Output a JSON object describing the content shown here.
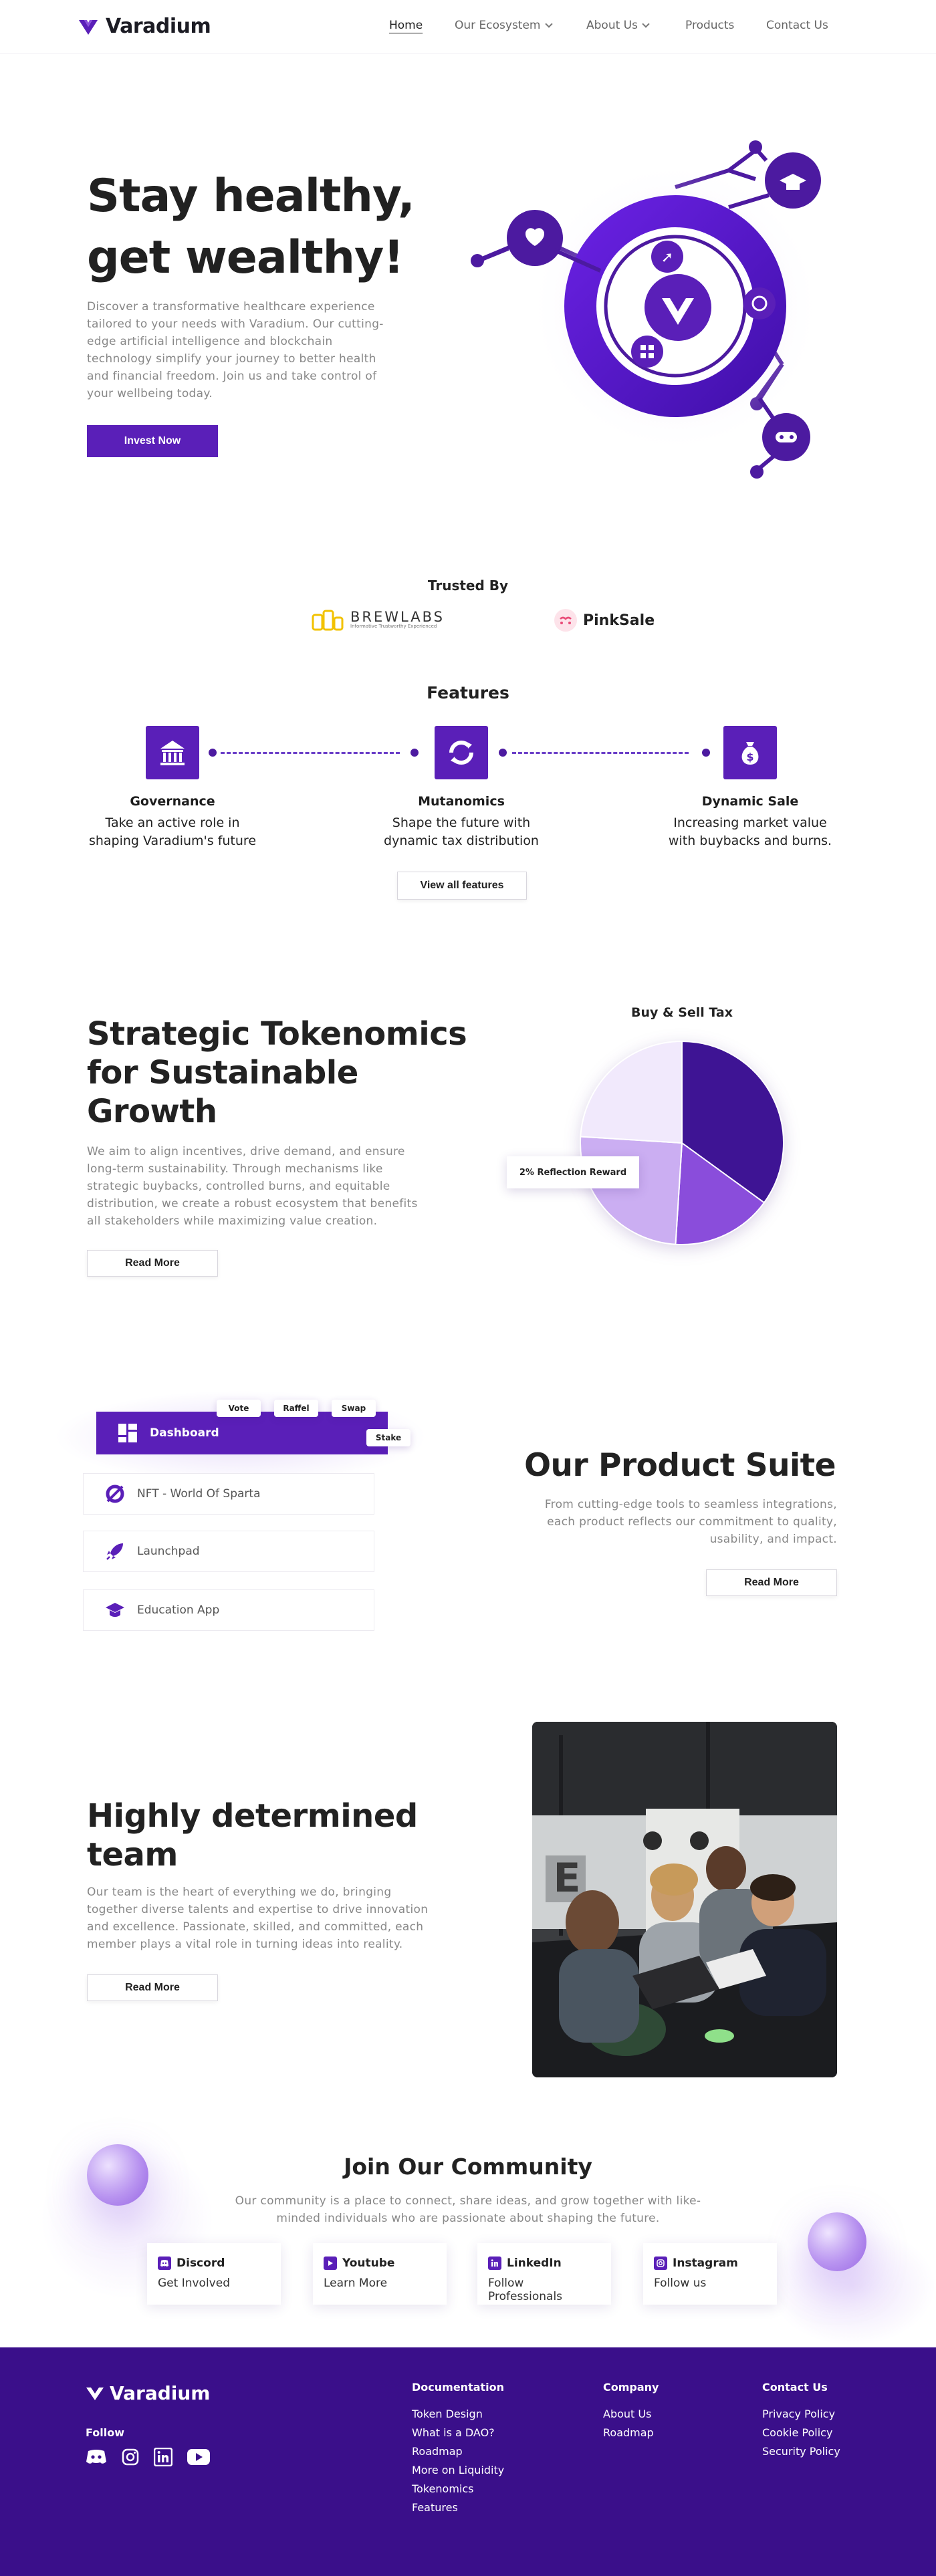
{
  "nav": {
    "brand": "Varadium",
    "items": [
      {
        "label": "Home"
      },
      {
        "label": "Our Ecosystem"
      },
      {
        "label": "About Us"
      },
      {
        "label": "Products"
      },
      {
        "label": "Contact Us"
      }
    ]
  },
  "hero": {
    "title_line1": "Stay healthy,",
    "title_line2": "get wealthy!",
    "text": "Discover a transformative healthcare experience tailored to your needs with Varadium. Our cutting-edge artificial intelligence and blockchain technology simplify your journey to better health and financial freedom. Join us and take control of your wellbeing today.",
    "cta": "Invest Now",
    "icons": [
      "heart-pulse-icon",
      "graduation-cap-icon",
      "rocket-icon",
      "refresh-icon",
      "apps-icon",
      "gamepad-icon",
      "varadium-logo"
    ]
  },
  "trusted": {
    "title": "Trusted By",
    "brewlabs": "BREWLABS",
    "brewlabs_tagline": "Informative Trustworthy Experienced",
    "pinksale": "PinkSale"
  },
  "features": {
    "title": "Features",
    "items": [
      {
        "name": "Governance",
        "desc_line1": "Take an active role in",
        "desc_line2": "shaping Varadium's future",
        "icon": "bank-icon"
      },
      {
        "name": "Mutanomics",
        "desc_line1": "Shape the future with",
        "desc_line2": "dynamic tax distribution",
        "icon": "cycle-icon"
      },
      {
        "name": "Dynamic Sale",
        "desc_line1": "Increasing market value",
        "desc_line2": "with buybacks and burns.",
        "icon": "money-bag-icon"
      }
    ],
    "cta": "View all features"
  },
  "tokenomics": {
    "title_line1": "Strategic Tokenomics",
    "title_line2": "for Sustainable",
    "title_line3": "Growth",
    "text": "We aim to align incentives, drive demand, and ensure long-term sustainability. Through mechanisms like strategic buybacks, controlled burns, and equitable distribution, we create a robust ecosystem that benefits all stakeholders while maximizing value creation.",
    "cta": "Read More"
  },
  "chart_data": {
    "type": "pie",
    "title": "Buy & Sell Tax",
    "slices": [
      {
        "label": "",
        "value": 35,
        "color": "#3e1494"
      },
      {
        "label": "",
        "value": 16,
        "color": "#8a4ddb"
      },
      {
        "label": "2% Reflection Reward",
        "value": 25,
        "color": "#cbaef2"
      },
      {
        "label": "",
        "value": 24,
        "color": "#f1e9fc"
      }
    ],
    "callout": "2% Reflection Reward"
  },
  "products": {
    "title": "Our Product Suite",
    "text": "From cutting-edge tools to seamless integrations, each product reflects our commitment to quality, usability, and impact.",
    "cta": "Read More",
    "dashboard": "Dashboard",
    "pills": [
      "Vote",
      "Raffel",
      "Swap",
      "Stake"
    ],
    "items": [
      {
        "label": "NFT - World Of Sparta",
        "icon": "sparta-icon"
      },
      {
        "label": "Launchpad",
        "icon": "rocket-icon"
      },
      {
        "label": "Education App",
        "icon": "graduation-cap-icon"
      }
    ]
  },
  "team": {
    "title_line1": "Highly determined",
    "title_line2": "team",
    "text": "Our team is the heart of everything we do, bringing together diverse talents and expertise to drive innovation and excellence. Passionate, skilled, and committed, each member plays a vital role in turning ideas into reality.",
    "cta": "Read More"
  },
  "community": {
    "title": "Join Our Community",
    "text_line1": "Our community is a place to connect, share ideas, and grow together with like-",
    "text_line2": "minded individuals who are passionate about shaping the future.",
    "cards": [
      {
        "title": "Discord",
        "sub": "Get Involved",
        "icon": "discord-icon"
      },
      {
        "title": "Youtube",
        "sub": "Learn More",
        "icon": "youtube-icon"
      },
      {
        "title": "LinkedIn",
        "sub": "Follow Professionals",
        "icon": "linkedin-icon"
      },
      {
        "title": "Instagram",
        "sub": "Follow us",
        "icon": "instagram-icon"
      }
    ]
  },
  "footer": {
    "brand": "Varadium",
    "follow": "Follow",
    "documentation": {
      "title": "Documentation",
      "links": [
        "Token Design",
        "What is a DAO?",
        "Roadmap",
        "More on Liquidity",
        "Tokenomics",
        "Features"
      ]
    },
    "company": {
      "title": "Company",
      "links": [
        "About Us",
        "Roadmap"
      ]
    },
    "contact": {
      "title": "Contact Us",
      "links": [
        "Privacy Policy",
        "Cookie Policy",
        "Security Policy"
      ]
    }
  },
  "colors": {
    "primary": "#5a1fb8",
    "footer": "#3a0f8a",
    "accent_light": "#cbaef2"
  }
}
